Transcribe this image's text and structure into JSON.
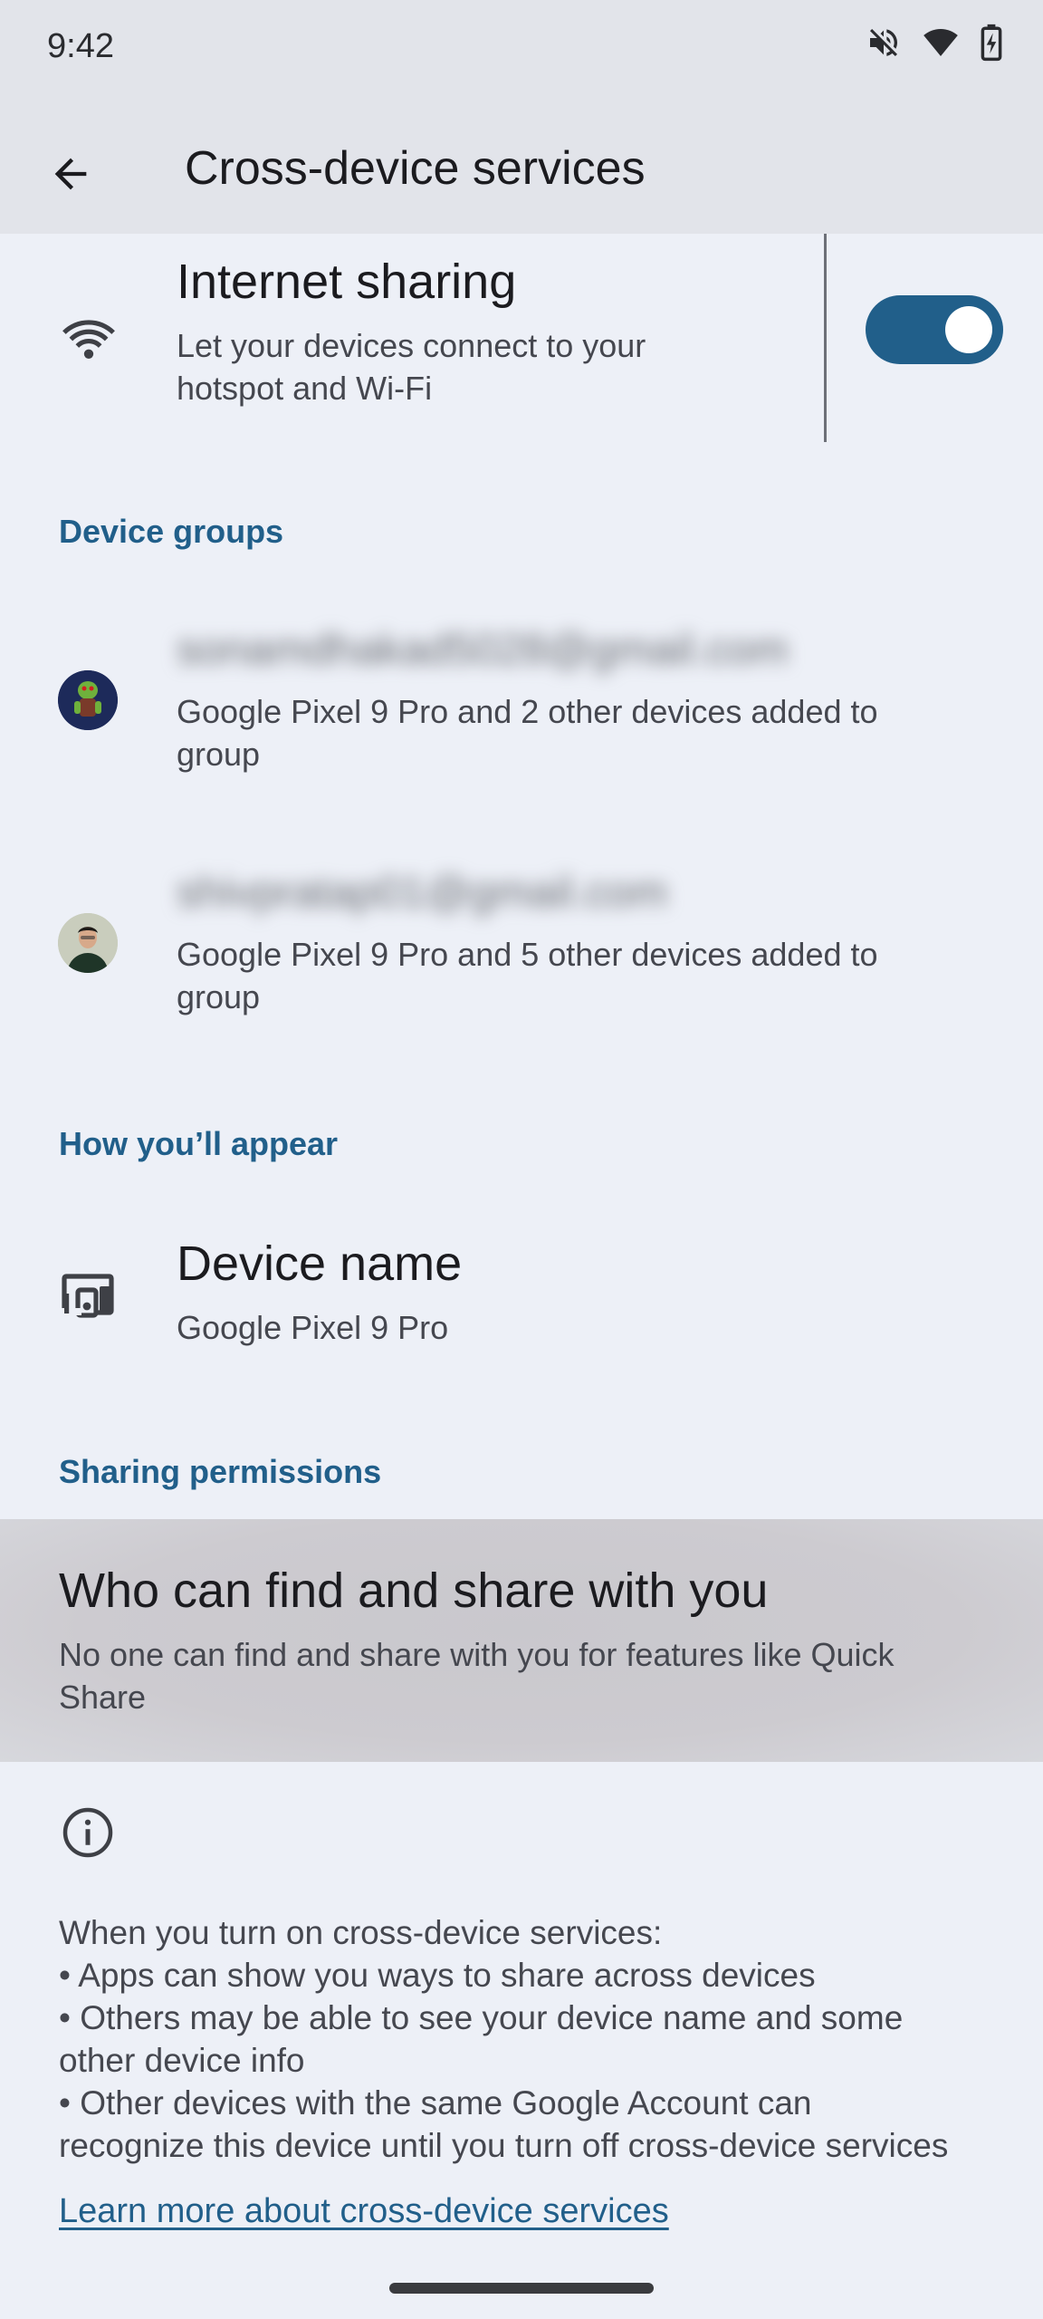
{
  "status_bar": {
    "time": "9:42",
    "icons": [
      "mute-icon",
      "wifi-icon",
      "battery-charging-icon"
    ]
  },
  "app_bar": {
    "title": "Cross-device services",
    "back_icon": "arrow-back-icon"
  },
  "internet_sharing": {
    "icon": "wifi-icon",
    "title": "Internet sharing",
    "subtitle_line1": "Let your devices connect to your",
    "subtitle_line2": "hotspot and Wi-Fi",
    "toggle_on": true
  },
  "device_groups": {
    "header": "Device groups",
    "accounts": [
      {
        "email": "sonamdhakad5028@gmail.com",
        "desc_line1": "Google Pixel 9 Pro and 2 other devices added to",
        "desc_line2": "group"
      },
      {
        "email": "shivpratap01@gmail.com",
        "desc_line1": "Google Pixel 9 Pro and 5 other devices added to",
        "desc_line2": "group"
      }
    ]
  },
  "appearance": {
    "header": "How you’ll appear",
    "device_name_title": "Device name",
    "device_name_value": "Google Pixel 9 Pro"
  },
  "permissions": {
    "header": "Sharing permissions",
    "title": "Who can find and share with you",
    "subtitle_line1": "No one can find and share with you for features like Quick",
    "subtitle_line2": "Share"
  },
  "info": {
    "icon": "info-icon",
    "lines": [
      "When you turn on cross-device services:",
      " • Apps can show you ways to share across devices",
      " • Others may be able to see your device name and some",
      "other device info",
      " • Other devices with the same Google Account can",
      "recognize this device until you turn off cross-device services"
    ],
    "learn_more": "Learn more about cross-device services"
  },
  "colors": {
    "background": "#edf0f7",
    "app_bar": "#e2e4ea",
    "accent": "#215f8a",
    "highlight_row": "#cdcbd0"
  }
}
